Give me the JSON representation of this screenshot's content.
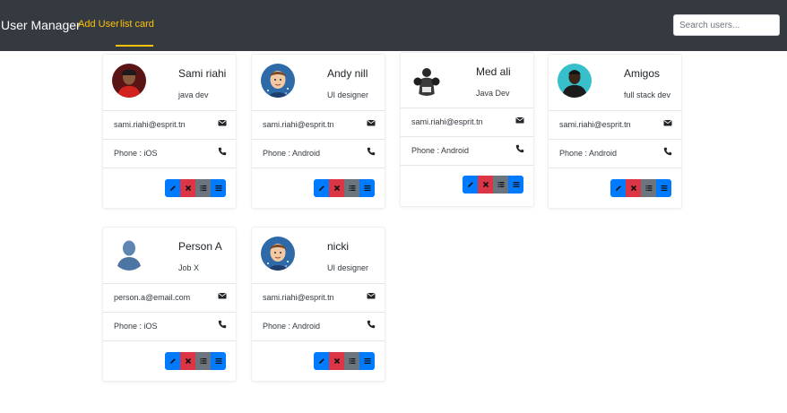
{
  "navbar": {
    "brand": "User Manager",
    "links": [
      "Add User",
      "list card"
    ],
    "search_placeholder": "Search users..."
  },
  "cards": [
    {
      "name": "Sami riahi",
      "job": "java dev",
      "email": "sami.riahi@esprit.tn",
      "phone": "Phone : iOS",
      "avatar": "photo-man-red-shirt"
    },
    {
      "name": "Andy nill",
      "job": "UI designer",
      "email": "sami.riahi@esprit.tn",
      "phone": "Phone : Android",
      "avatar": "cartoon-boy-avatar"
    },
    {
      "name": "Med ali",
      "job": "Java Dev",
      "email": "sami.riahi@esprit.tn",
      "phone": "Phone : Android",
      "avatar": "photo-boxer-bw"
    },
    {
      "name": "Amigos",
      "job": "full stack dev",
      "email": "sami.riahi@esprit.tn",
      "phone": "Phone : Android",
      "avatar": "photo-man-teal-bg"
    },
    {
      "name": "Person A",
      "job": "Job X",
      "email": "person.a@email.com",
      "phone": "Phone : iOS",
      "avatar": "placeholder-silhouette"
    },
    {
      "name": "nicki",
      "job": "UI designer",
      "email": "sami.riahi@esprit.tn",
      "phone": "Phone : Android",
      "avatar": "cartoon-boy-avatar"
    }
  ],
  "icons": {
    "email": "envelope-icon",
    "phone": "phone-icon",
    "actions": [
      "pencil-icon",
      "times-icon",
      "list-icon",
      "bars-icon"
    ]
  },
  "colors": {
    "navbar_bg": "#343a40",
    "nav_link": "#ffc107",
    "btn_primary": "#007bff",
    "btn_danger": "#dc3545",
    "btn_secondary": "#6c757d"
  }
}
